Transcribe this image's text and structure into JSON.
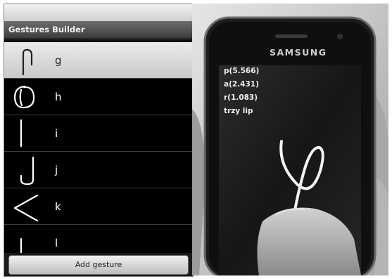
{
  "app": {
    "title": "Gestures Builder",
    "add_button_label": "Add gesture",
    "gestures": [
      {
        "label": "g",
        "icon": "gesture-g-icon",
        "selected": true
      },
      {
        "label": "h",
        "icon": "gesture-h-icon",
        "selected": false
      },
      {
        "label": "i",
        "icon": "gesture-i-icon",
        "selected": false
      },
      {
        "label": "j",
        "icon": "gesture-j-icon",
        "selected": false
      },
      {
        "label": "k",
        "icon": "gesture-k-icon",
        "selected": false
      },
      {
        "label": "l",
        "icon": "gesture-l-icon",
        "selected": false
      }
    ]
  },
  "phone": {
    "brand": "SAMSUNG",
    "readout": [
      "p(5.566)",
      "a(2.431)",
      "r(1.083)",
      "trzy lip"
    ]
  },
  "colors": {
    "list_background": "#000000",
    "selected_row": "#dcdcdc",
    "title_bar": "#505050"
  }
}
